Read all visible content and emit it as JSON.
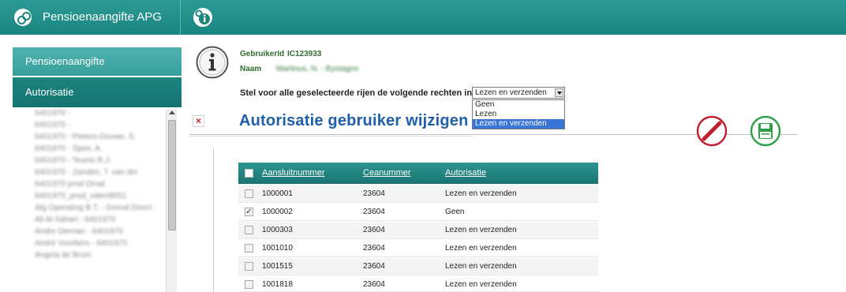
{
  "app": {
    "title": "Pensioenaangifte APG"
  },
  "sidebar": {
    "nav": [
      {
        "label": "Pensioenaangifte"
      },
      {
        "label": "Autorisatie"
      }
    ],
    "list_items": [
      "6401970 -",
      "6401970 -",
      "6401970 - Pieters-Douwe, S.",
      "6401970 - Spee, A.",
      "6401970 - Teunis R.J.",
      "6401970 - Zanden, T. van der",
      "6401970 prod Ornal",
      "6401970_prod_valeri8001",
      "Afg Operating B.T. - Domal Direct",
      "Ali Al-Sahari - 6401970",
      "Andre Dieman - 6401970",
      "André Voorbers - 6401970",
      "Angela de Bruin"
    ]
  },
  "user": {
    "id_label": "GebruikerId",
    "id_value": "IC123933",
    "name_label": "Naam",
    "name_value": "Martinus, N. - Bystagno"
  },
  "prompt": "Stel voor alle geselecteerde rijen de volgende rechten in:",
  "rights_select": {
    "value": "Lezen en verzenden",
    "options": [
      "Geen",
      "Lezen",
      "Lezen en verzenden"
    ],
    "selected_index": 2
  },
  "page_title": "Autorisatie gebruiker wijzigen",
  "icons": {
    "close": "close-icon",
    "cancel": "no-entry-icon",
    "save": "floppy-disk-icon",
    "info": "info-icon"
  },
  "colors": {
    "brand_teal": "#1b8580",
    "title_blue": "#1f5faa",
    "cancel_red": "#c0202e",
    "save_green": "#2ea046"
  },
  "table": {
    "columns": [
      "Aansluitnummer",
      "Ceanummer",
      "Autorisatie"
    ],
    "rows": [
      {
        "checked": false,
        "aansluitnummer": "1000001",
        "ceanummer": "23604",
        "autorisatie": "Lezen en verzenden"
      },
      {
        "checked": true,
        "aansluitnummer": "1000002",
        "ceanummer": "23604",
        "autorisatie": "Geen"
      },
      {
        "checked": false,
        "aansluitnummer": "1000303",
        "ceanummer": "23604",
        "autorisatie": "Lezen en verzenden"
      },
      {
        "checked": false,
        "aansluitnummer": "1001010",
        "ceanummer": "23604",
        "autorisatie": "Lezen en verzenden"
      },
      {
        "checked": false,
        "aansluitnummer": "1001515",
        "ceanummer": "23604",
        "autorisatie": "Lezen en verzenden"
      },
      {
        "checked": false,
        "aansluitnummer": "1001818",
        "ceanummer": "23604",
        "autorisatie": "Lezen en verzenden"
      }
    ]
  }
}
